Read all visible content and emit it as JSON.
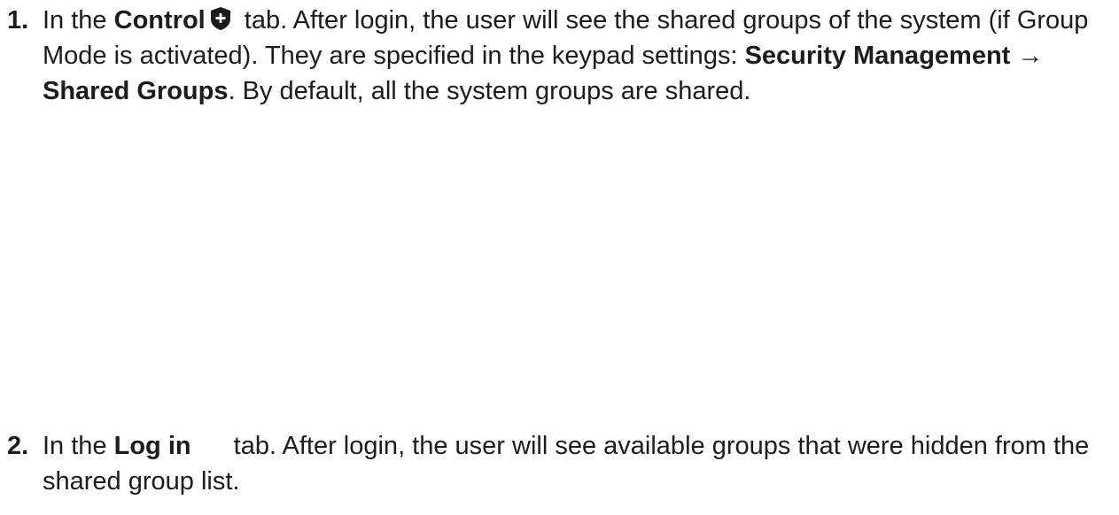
{
  "steps": [
    {
      "number": "1.",
      "pre": "In the ",
      "tab_name": "Control",
      "tab_icon": "shield-plus-icon",
      "sentence_a": " tab. After login, the user will see the shared groups of the system (if Group Mode is activated). They are specified in the keypad settings: ",
      "menu_path_1": "Security Management",
      "arrow": " → ",
      "menu_path_2": "Shared Groups",
      "sentence_b": ". By default, all the system groups are shared."
    },
    {
      "number": "2.",
      "pre": "In the ",
      "tab_name": "Log in",
      "sentence_a": " tab. After login, the user will see available groups that were hidden from the shared group list."
    }
  ]
}
